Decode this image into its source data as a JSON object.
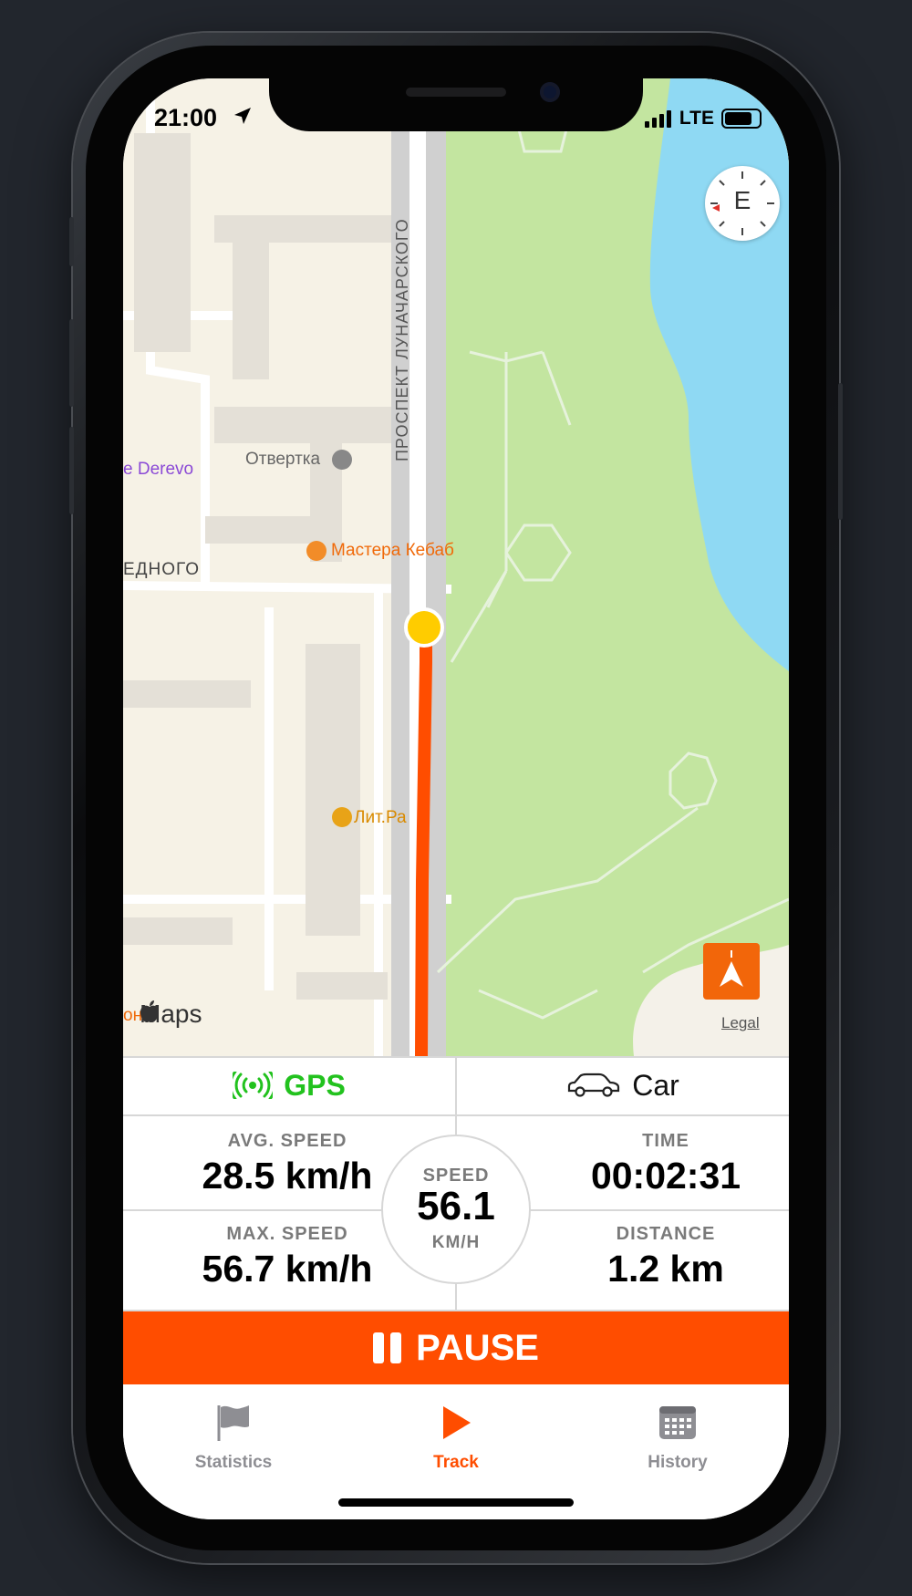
{
  "status_bar": {
    "time": "21:00",
    "network": "LTE",
    "battery_level": 0.8
  },
  "map": {
    "street_label": "ПРОСПЕКТ ЛУНАЧАРСКОГО",
    "poi_otvertka": "Отвертка",
    "poi_derevo": "e Derevo",
    "poi_kebab": "Мастера Кебаб",
    "poi_lit": "Лит.Ра",
    "street_left": "ЕДНОГО",
    "left_edge_text": "он",
    "compass_heading": "E",
    "maps_brand": "Maps",
    "legal": "Legal",
    "route_color": "#ff4d00",
    "position_color": "#ffcc00"
  },
  "panel": {
    "gps_label": "GPS",
    "gps_color": "#22c21e",
    "vehicle_label": "Car",
    "avg_speed_label": "AVG. SPEED",
    "avg_speed_value": "28.5 km/h",
    "max_speed_label": "MAX. SPEED",
    "max_speed_value": "56.7 km/h",
    "speed_label": "SPEED",
    "speed_value": "56.1",
    "speed_unit": "KM/H",
    "time_label": "TIME",
    "time_value": "00:02:31",
    "distance_label": "DISTANCE",
    "distance_value": "1.2 km"
  },
  "pause_button": {
    "label": "PAUSE",
    "color": "#ff4d00"
  },
  "tabs": [
    {
      "label": "Statistics",
      "icon": "flag-icon",
      "active": false
    },
    {
      "label": "Track",
      "icon": "play-icon",
      "active": true
    },
    {
      "label": "History",
      "icon": "calendar-icon",
      "active": false
    }
  ],
  "colors": {
    "accent": "#ff4d00",
    "tab_inactive": "#8e8e93"
  }
}
